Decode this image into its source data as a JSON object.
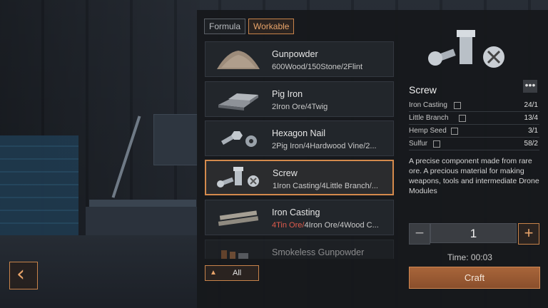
{
  "tabs": [
    {
      "label": "Formula",
      "active": false
    },
    {
      "label": "Workable",
      "active": true
    }
  ],
  "items": [
    {
      "name": "Gunpowder",
      "recipe": "600Wood/150Stone/2Flint",
      "icon": "gunpowder-pile-icon"
    },
    {
      "name": "Pig Iron",
      "recipe": "2Iron Ore/4Twig",
      "icon": "iron-ingot-icon"
    },
    {
      "name": "Hexagon Nail",
      "recipe": "2Pig Iron/4Hardwood Vine/2...",
      "icon": "hexagon-nail-icon"
    },
    {
      "name": "Screw",
      "recipe": "1Iron Casting/4Little Branch/...",
      "icon": "screw-icon",
      "selected": true
    },
    {
      "name": "Iron Casting",
      "recipe_short": "4Tin Ore/",
      "recipe": "4Iron Ore/4Wood C...",
      "icon": "iron-bar-icon"
    },
    {
      "name": "Smokeless Gunpowder",
      "recipe": "",
      "icon": "smokeless-gunpowder-icon"
    }
  ],
  "filter": {
    "label": "All"
  },
  "detail": {
    "title": "Screw",
    "more": "•••",
    "ingredients": [
      {
        "name": "Iron Casting",
        "count": "24/1"
      },
      {
        "name": "Little Branch",
        "count": "13/4"
      },
      {
        "name": "Hemp Seed",
        "count": "3/1"
      },
      {
        "name": "Sulfur",
        "count": "58/2"
      }
    ],
    "description": "A precise component made from rare ore. A precious material for making weapons, tools and intermediate Drone Modules",
    "quantity": "1",
    "minus": "−",
    "plus": "+",
    "time": "Time: 00:03",
    "craft_label": "Craft"
  },
  "back": "‹",
  "colors": {
    "accent": "#c8834a",
    "shortage": "#e05b4c"
  }
}
